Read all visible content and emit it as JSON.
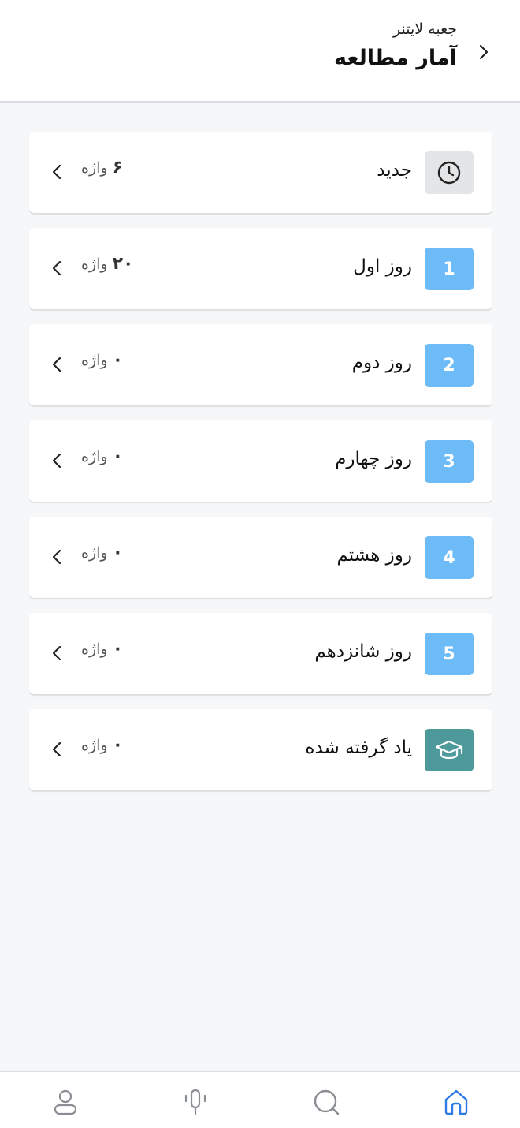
{
  "header": {
    "subtitle": "جعبه لایتنر",
    "title": "آمار مطالعه"
  },
  "rows": [
    {
      "label": "جدید",
      "badge": "",
      "icon": "clock-icon",
      "count": "۶",
      "unit": "واژه"
    },
    {
      "label": "روز اول",
      "badge": "1",
      "icon": "",
      "count": "۲۰",
      "unit": "واژه"
    },
    {
      "label": "روز دوم",
      "badge": "2",
      "icon": "",
      "count": "۰",
      "unit": "واژه"
    },
    {
      "label": "روز چهارم",
      "badge": "3",
      "icon": "",
      "count": "۰",
      "unit": "واژه"
    },
    {
      "label": "روز هشتم",
      "badge": "4",
      "icon": "",
      "count": "۰",
      "unit": "واژه"
    },
    {
      "label": "روز شانزدهم",
      "badge": "5",
      "icon": "",
      "count": "۰",
      "unit": "واژه"
    },
    {
      "label": "یاد گرفته شده",
      "badge": "",
      "icon": "graduation-cap-icon",
      "count": "۰",
      "unit": "واژه"
    }
  ],
  "colors": {
    "badge_new": "#e4e5e7",
    "badge_day": "#6dbcf8",
    "badge_learned": "#4e9a9b",
    "tab_active": "#2f7be5",
    "tab_inactive": "#8a8d92"
  },
  "tabs": [
    {
      "icon": "profile-icon"
    },
    {
      "icon": "microphone-icon"
    },
    {
      "icon": "search-icon"
    },
    {
      "icon": "home-icon"
    }
  ]
}
